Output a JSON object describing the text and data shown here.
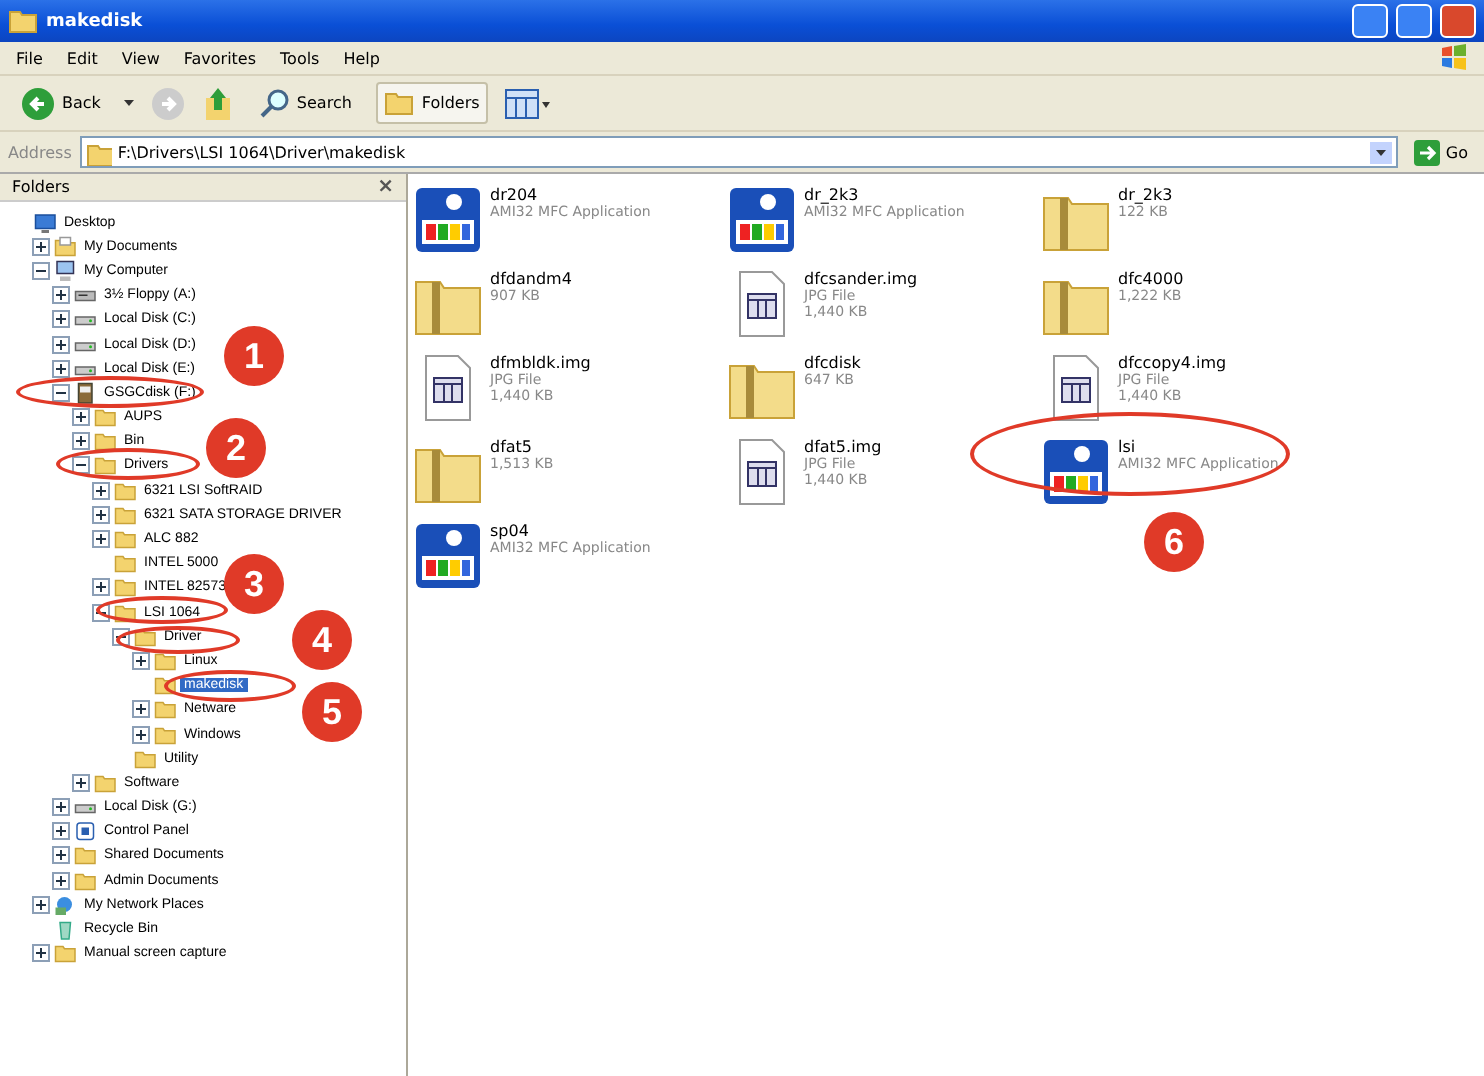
{
  "window": {
    "title": "makedisk"
  },
  "menu": [
    "File",
    "Edit",
    "View",
    "Favorites",
    "Tools",
    "Help"
  ],
  "toolbar": {
    "back": "Back",
    "search": "Search",
    "folders": "Folders"
  },
  "address": {
    "label": "Address",
    "value": "F:\\Drivers\\LSI 1064\\Driver\\makedisk",
    "go": "Go"
  },
  "folders_pane": {
    "title": "Folders",
    "close": "×",
    "tree": [
      {
        "label": "Desktop",
        "kind": "desktop",
        "selected": false,
        "children": [
          {
            "label": "My Documents",
            "kind": "documents",
            "expanded": false,
            "selected": false
          },
          {
            "label": "My Computer",
            "kind": "computer",
            "expanded": true,
            "selected": false,
            "children": [
              {
                "label": "3½ Floppy (A:)",
                "kind": "floppy",
                "expanded": false,
                "selected": false
              },
              {
                "label": "Local Disk (C:)",
                "kind": "drive",
                "expanded": false,
                "selected": false
              },
              {
                "label": "Local Disk (D:)",
                "kind": "drive",
                "expanded": false,
                "selected": false
              },
              {
                "label": "Local Disk (E:)",
                "kind": "drive",
                "expanded": false,
                "selected": false
              },
              {
                "label": "GSGCdisk (F:)",
                "kind": "cd",
                "expanded": true,
                "selected": false,
                "children": [
                  {
                    "label": "AUPS",
                    "kind": "folder",
                    "expanded": false,
                    "selected": false
                  },
                  {
                    "label": "Bin",
                    "kind": "folder",
                    "expanded": false,
                    "selected": false
                  },
                  {
                    "label": "Drivers",
                    "kind": "folder",
                    "expanded": true,
                    "selected": false,
                    "children": [
                      {
                        "label": "6321 LSI SoftRAID",
                        "kind": "folder",
                        "expanded": false,
                        "selected": false
                      },
                      {
                        "label": "6321 SATA STORAGE DRIVER",
                        "kind": "folder",
                        "expanded": false,
                        "selected": false
                      },
                      {
                        "label": "ALC 882",
                        "kind": "folder",
                        "expanded": false,
                        "selected": false
                      },
                      {
                        "label": "INTEL 5000",
                        "kind": "folder",
                        "selected": false
                      },
                      {
                        "label": "INTEL 82573",
                        "kind": "folder",
                        "expanded": false,
                        "selected": false
                      },
                      {
                        "label": "LSI 1064",
                        "kind": "folder",
                        "expanded": true,
                        "selected": false,
                        "children": [
                          {
                            "label": "Driver",
                            "kind": "folder",
                            "expanded": true,
                            "selected": false,
                            "children": [
                              {
                                "label": "Linux",
                                "kind": "folder",
                                "expanded": false,
                                "selected": false
                              },
                              {
                                "label": "makedisk",
                                "kind": "folder",
                                "selected": true
                              },
                              {
                                "label": "Netware",
                                "kind": "folder",
                                "expanded": false,
                                "selected": false
                              },
                              {
                                "label": "Windows",
                                "kind": "folder",
                                "expanded": false,
                                "selected": false
                              }
                            ]
                          },
                          {
                            "label": "Utility",
                            "kind": "folder",
                            "selected": false
                          }
                        ]
                      }
                    ]
                  },
                  {
                    "label": "Software",
                    "kind": "folder",
                    "expanded": false,
                    "selected": false
                  }
                ]
              },
              {
                "label": "Local Disk (G:)",
                "kind": "drive",
                "expanded": false,
                "selected": false
              },
              {
                "label": "Control Panel",
                "kind": "panel",
                "expanded": false,
                "selected": false
              },
              {
                "label": "Shared Documents",
                "kind": "folder",
                "expanded": false,
                "selected": false
              },
              {
                "label": "Admin Documents",
                "kind": "folder",
                "expanded": false,
                "selected": false
              }
            ]
          },
          {
            "label": "My Network Places",
            "kind": "network",
            "expanded": false,
            "selected": false
          },
          {
            "label": "Recycle Bin",
            "kind": "recycle",
            "selected": false
          },
          {
            "label": "Manual screen capture",
            "kind": "folder",
            "expanded": false,
            "selected": false
          }
        ]
      }
    ]
  },
  "files": [
    {
      "name": "dr204",
      "kind": "app",
      "detail": [
        "AMI32 MFC Application"
      ]
    },
    {
      "name": "dr_2k3",
      "kind": "app",
      "detail": [
        "AMI32 MFC Application"
      ]
    },
    {
      "name": "dr_2k3",
      "kind": "zip",
      "detail": [
        "122 KB"
      ]
    },
    {
      "name": "dfdandm4",
      "kind": "zip",
      "detail": [
        "907 KB"
      ]
    },
    {
      "name": "dfcsander.img",
      "kind": "image",
      "detail": [
        "JPG File",
        "1,440 KB"
      ]
    },
    {
      "name": "dfc4000",
      "kind": "zip",
      "detail": [
        "1,222 KB"
      ]
    },
    {
      "name": "dfmbldk.img",
      "kind": "image",
      "detail": [
        "JPG File",
        "1,440 KB"
      ]
    },
    {
      "name": "dfcdisk",
      "kind": "zip",
      "detail": [
        "647 KB"
      ]
    },
    {
      "name": "dfccopy4.img",
      "kind": "image",
      "detail": [
        "JPG File",
        "1,440 KB"
      ]
    },
    {
      "name": "dfat5",
      "kind": "zip",
      "detail": [
        "1,513 KB"
      ]
    },
    {
      "name": "dfat5.img",
      "kind": "image",
      "detail": [
        "JPG File",
        "1,440 KB"
      ]
    },
    {
      "name": "lsi",
      "kind": "app",
      "detail": [
        "AMI32 MFC Application"
      ]
    },
    {
      "name": "sp04",
      "kind": "app",
      "detail": [
        "AMI32 MFC Application"
      ]
    }
  ],
  "callouts": [
    "1",
    "2",
    "3",
    "4",
    "5",
    "6"
  ]
}
